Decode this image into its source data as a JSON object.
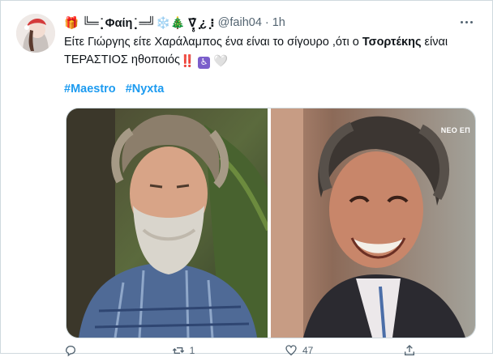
{
  "tweet": {
    "display_name": "🎁 ╚═ ̣̥̇ Φαίη ̣̥̇ ═╝❄️🎄 ∇̣̥̇ ̣̥¿ ̣̥⁝",
    "handle": "@faih04",
    "separator": "·",
    "time": "1h",
    "text_part1": "Είτε Γιώργης είτε Χαράλαμπος ένα είναι το σίγουρο ,ότι ο ",
    "text_bold": "Τσορτέκης",
    "text_part2": " είναι",
    "text_line2": "ΤΕΡΑΣΤΙΟΣ ηθοποιός",
    "emoji_double_exclaim": "‼️",
    "emoji_heart": "🤍",
    "hashtags": [
      "#Maestro",
      "#Nyxta"
    ],
    "media_watermark": "ΝΕΟ ΕΠ",
    "colors": {
      "accent": "#1d9bf0",
      "text": "#0f1419",
      "secondary": "#536471"
    },
    "actions": {
      "reply_count": "",
      "retweet_count": "1",
      "like_count": "47",
      "share_count": ""
    }
  }
}
